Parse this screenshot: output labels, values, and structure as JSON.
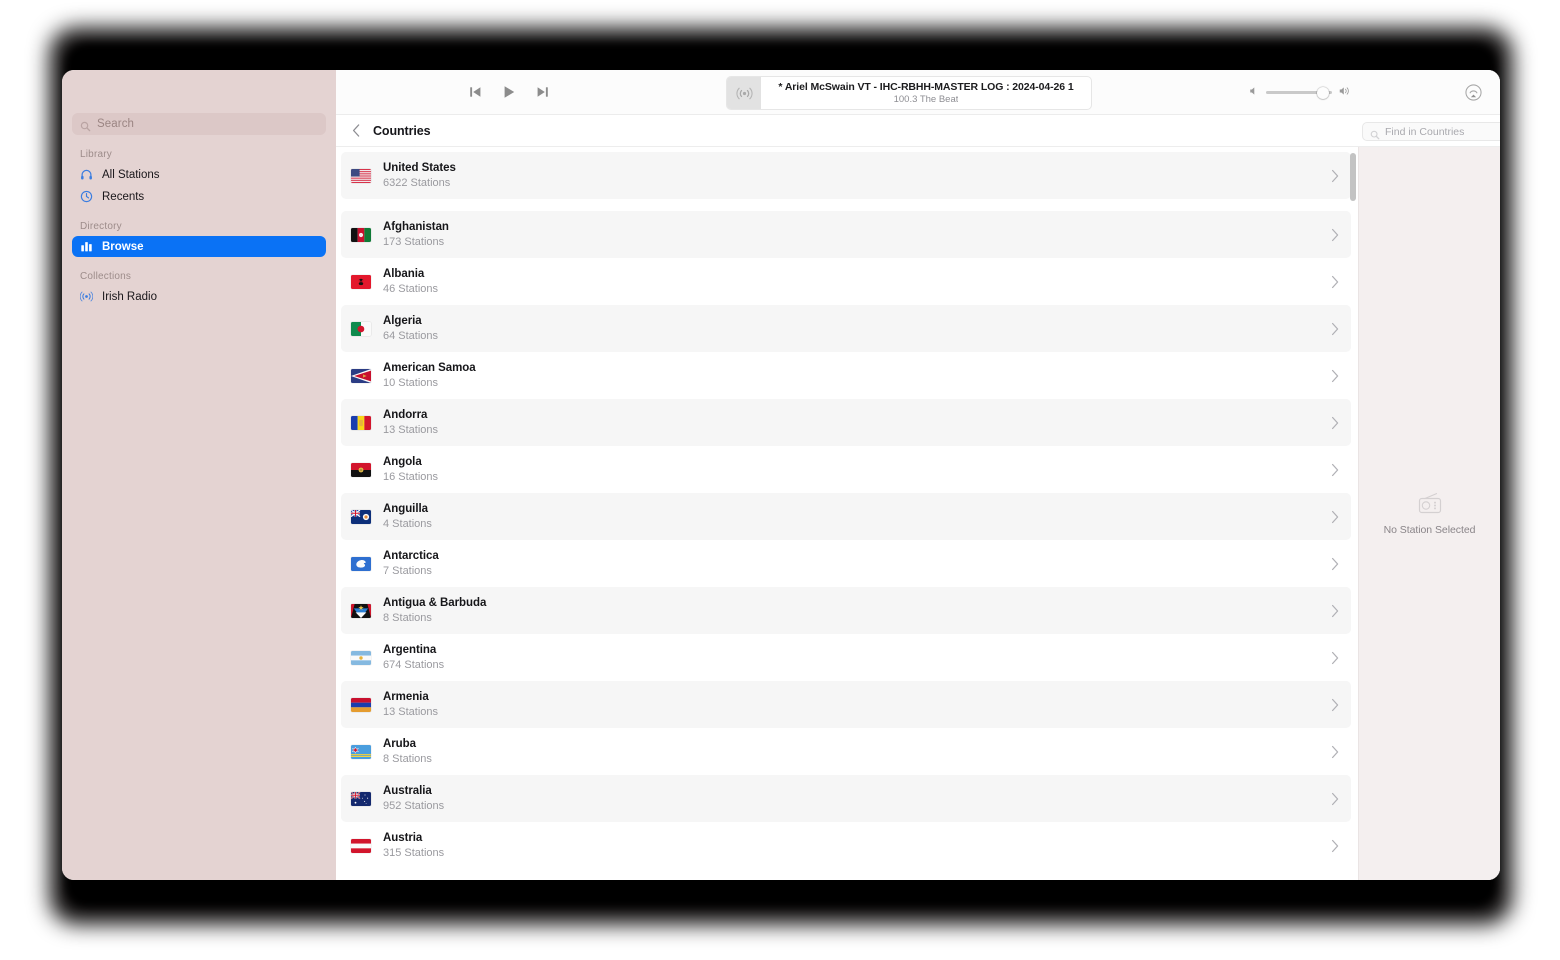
{
  "app": {
    "sidebar": {
      "search": {
        "placeholder": "Search",
        "value": "",
        "icon": "search-icon"
      },
      "sections": [
        {
          "title": "Library",
          "items": [
            {
              "label": "All Stations",
              "icon": "headphones-icon",
              "selected": false
            },
            {
              "label": "Recents",
              "icon": "clock-icon",
              "selected": false
            }
          ]
        },
        {
          "title": "Directory",
          "items": [
            {
              "label": "Browse",
              "icon": "browse-chart-icon",
              "selected": true
            }
          ]
        },
        {
          "title": "Collections",
          "items": [
            {
              "label": "Irish Radio",
              "icon": "broadcast-icon",
              "selected": false
            }
          ]
        }
      ]
    },
    "toolbar": {
      "previous_label": "Previous",
      "play_label": "Play",
      "next_label": "Next",
      "now_playing": {
        "title": "* Ariel McSwain VT - IHC-RBHH-MASTER LOG : 2024-04-26 1",
        "subtitle": "100.3 The Beat",
        "art_icon": "broadcast-icon"
      },
      "volume": {
        "level_percent": 86,
        "min_icon": "speaker-low-icon",
        "max_icon": "speaker-high-icon"
      },
      "airplay_label": "AirPlay"
    },
    "navbar": {
      "back_label": "Back",
      "title": "Countries",
      "find": {
        "placeholder": "Find in Countries",
        "value": "",
        "icon": "search-icon"
      }
    },
    "detail": {
      "icon": "radio-icon",
      "empty_label": "No Station Selected"
    },
    "colors": {
      "sidebar_bg": "#e4d3d2",
      "accent_selected": "#0a72f5",
      "detail_bg": "#f4efef",
      "row_shaded": "#f6f6f6"
    },
    "list": {
      "pinned": [
        {
          "name": "United States",
          "stations": "6322 Stations",
          "flag": "us",
          "shaded": true
        }
      ],
      "rows": [
        {
          "name": "Afghanistan",
          "stations": "173 Stations",
          "flag": "af",
          "shaded": true
        },
        {
          "name": "Albania",
          "stations": "46 Stations",
          "flag": "al",
          "shaded": false
        },
        {
          "name": "Algeria",
          "stations": "64 Stations",
          "flag": "dz",
          "shaded": true
        },
        {
          "name": "American Samoa",
          "stations": "10 Stations",
          "flag": "as",
          "shaded": false
        },
        {
          "name": "Andorra",
          "stations": "13 Stations",
          "flag": "ad",
          "shaded": true
        },
        {
          "name": "Angola",
          "stations": "16 Stations",
          "flag": "ao",
          "shaded": false
        },
        {
          "name": "Anguilla",
          "stations": "4 Stations",
          "flag": "ai",
          "shaded": true
        },
        {
          "name": "Antarctica",
          "stations": "7 Stations",
          "flag": "aq",
          "shaded": false
        },
        {
          "name": "Antigua & Barbuda",
          "stations": "8 Stations",
          "flag": "ag",
          "shaded": true
        },
        {
          "name": "Argentina",
          "stations": "674 Stations",
          "flag": "ar",
          "shaded": false
        },
        {
          "name": "Armenia",
          "stations": "13 Stations",
          "flag": "am",
          "shaded": true
        },
        {
          "name": "Aruba",
          "stations": "8 Stations",
          "flag": "aw",
          "shaded": false
        },
        {
          "name": "Australia",
          "stations": "952 Stations",
          "flag": "au",
          "shaded": true
        },
        {
          "name": "Austria",
          "stations": "315 Stations",
          "flag": "at",
          "shaded": false
        }
      ]
    }
  }
}
